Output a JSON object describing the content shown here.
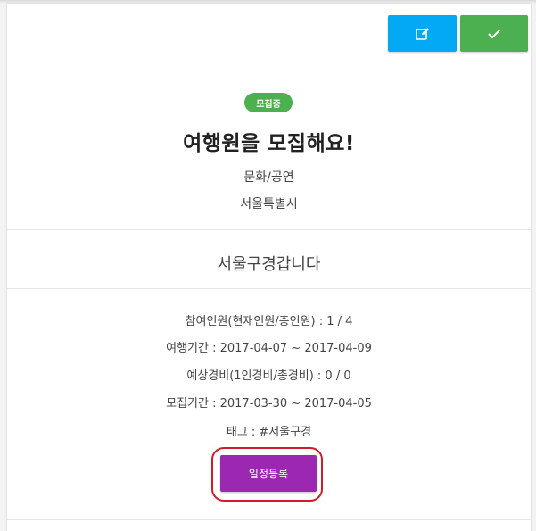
{
  "header": {
    "edit_icon": "edit-icon",
    "confirm_icon": "check-icon"
  },
  "post": {
    "status_badge": "모집중",
    "title": "여행원을 모집해요!",
    "category": "문화/공연",
    "region": "서울특별시",
    "subtitle": "서울구경갑니다"
  },
  "details": {
    "participants": "참여인원(현재인원/총인원) : 1 / 4",
    "travel_period": "여행기간 : 2017-04-07 ~ 2017-04-09",
    "expected_cost": "예상경비(1인경비/총경비) : 0 / 0",
    "recruit_period": "모집기간 : 2017-03-30 ~ 2017-04-05",
    "tags": "태그 : #서울구경"
  },
  "actions": {
    "register_label": "일정등록"
  },
  "colors": {
    "edit_button": "#03a9f4",
    "confirm_button": "#4caf50",
    "badge": "#4caf50",
    "register_button": "#9c27b0",
    "highlight_ring": "#d11a2a"
  }
}
